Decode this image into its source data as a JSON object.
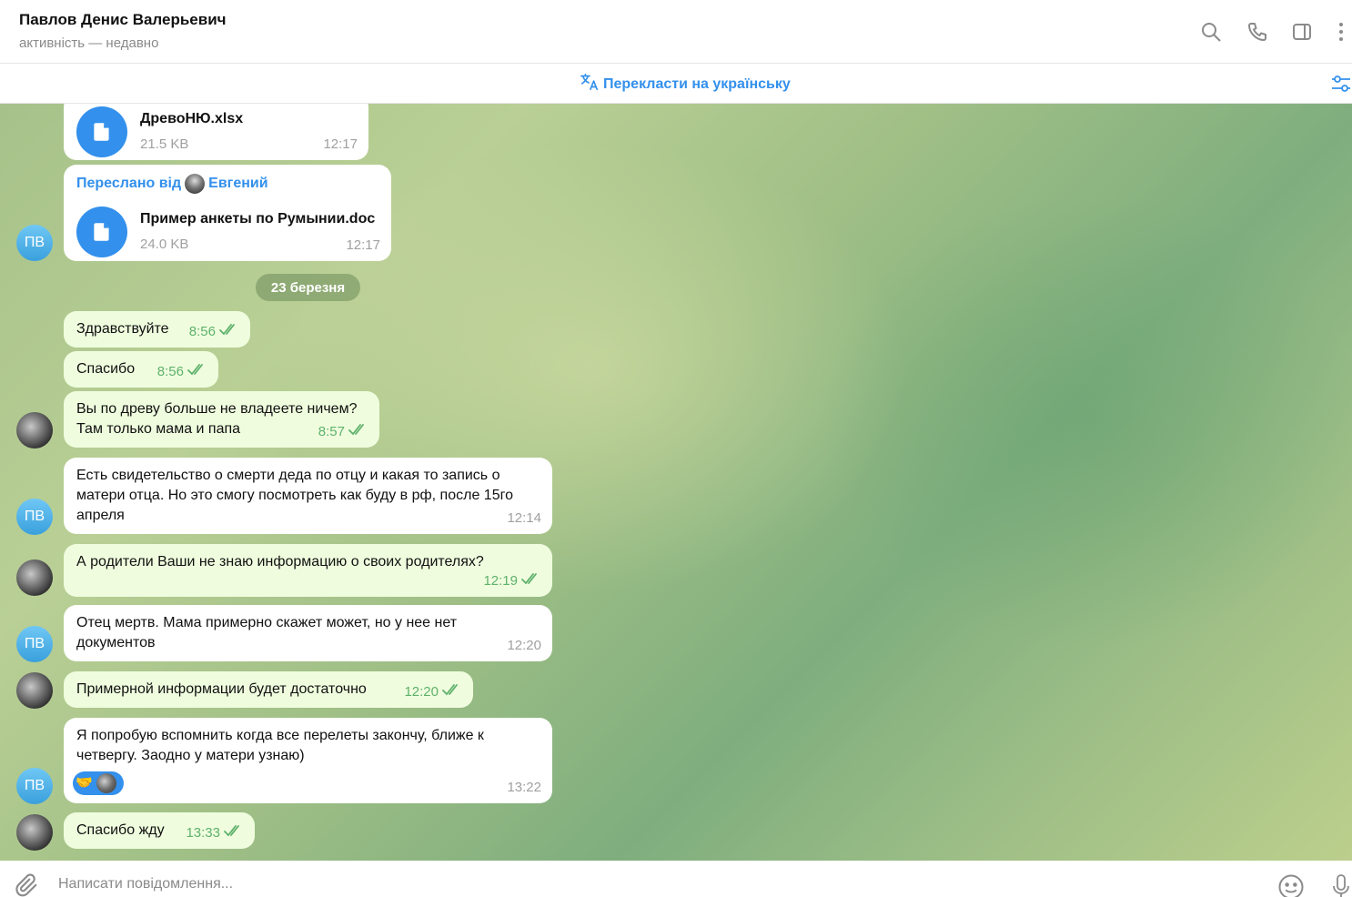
{
  "header": {
    "contact_name": "Павлов Денис Валерьевич",
    "status": "активність — недавно"
  },
  "translate_bar": {
    "label": "Перекласти на українську"
  },
  "contact_initials": "ПВ",
  "date_separator": "23 березня",
  "files": [
    {
      "name": "ДревоНЮ.xlsx",
      "size": "21.5 KB",
      "time": "12:17"
    },
    {
      "forwarded_prefix": "Переслано від",
      "forwarded_from": "Евгений",
      "name": "Пример анкеты по Румынии.doc",
      "size": "24.0 KB",
      "time": "12:17"
    }
  ],
  "messages": [
    {
      "text": "Здравствуйте",
      "time": "8:56"
    },
    {
      "text": "Спасибо",
      "time": "8:56"
    },
    {
      "line1": "Вы по древу больше не владеете ничем?",
      "line2": "Там только мама и папа",
      "time": "8:57"
    },
    {
      "line1": "Есть свидетельство о смерти деда по отцу и какая то запись о",
      "line2": "матери отца. Но это смогу посмотреть как буду в рф, после 15го",
      "line3": "апреля",
      "time": "12:14"
    },
    {
      "text": "А родители Ваши не знаю информацию о своих родителях?",
      "time": "12:19"
    },
    {
      "line1": "Отец мертв. Мама примерно скажет может, но у нее нет",
      "line2": "документов",
      "time": "12:20"
    },
    {
      "text": "Примерной информации будет достаточно",
      "time": "12:20"
    },
    {
      "line1": "Я попробую вспомнить когда все перелеты закончу, ближе к",
      "line2": "четвергу. Заодно у матери узнаю)",
      "reaction": "🤝",
      "time": "13:22"
    },
    {
      "text": "Спасибо жду",
      "time": "13:33"
    }
  ],
  "composer": {
    "placeholder": "Написати повідомлення..."
  },
  "colors": {
    "accent": "#3390ec",
    "outgoing_bubble": "#effdde",
    "incoming_bubble": "#ffffff",
    "read_check": "#5fb16c"
  }
}
